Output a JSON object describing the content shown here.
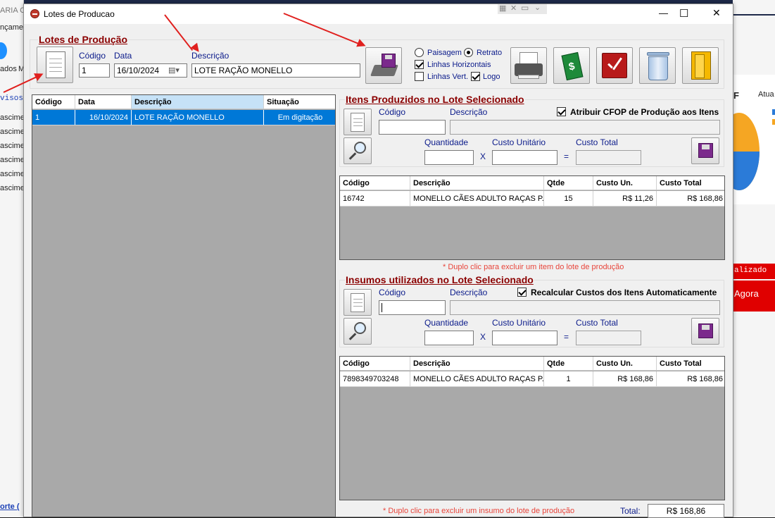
{
  "background": {
    "left_texts": [
      "ARIA C",
      "nçame",
      "ados",
      "M",
      "visos",
      "ascime",
      "ascime",
      "ascime",
      "ascime",
      "ascime",
      "ascime",
      "orte ("
    ],
    "right_texts": [
      "F",
      "Atua",
      "alizado",
      "Agora"
    ]
  },
  "window": {
    "title": "Lotes de Producao",
    "controls": {
      "minimize": "—",
      "maximize": "☐",
      "close": "✕"
    }
  },
  "header": {
    "section_title": "Lotes de Produção",
    "codigo_label": "Código",
    "codigo_value": "1",
    "data_label": "Data",
    "data_value": "16/10/2024",
    "descricao_label": "Descrição",
    "descricao_value": "LOTE RAÇÃO MONELLO"
  },
  "print_options": {
    "paisagem": "Paisagem",
    "retrato": "Retrato",
    "linhas_horizontais": "Linhas Horizontais",
    "linhas_vert": "Linhas Vert.",
    "logo": "Logo",
    "paisagem_selected": false,
    "retrato_selected": true,
    "linhas_horizontais_checked": true,
    "linhas_vert_checked": false,
    "logo_checked": true
  },
  "lots_table": {
    "headers": [
      "Código",
      "Data",
      "Descrição",
      "Situação"
    ],
    "rows": [
      {
        "codigo": "1",
        "data": "16/10/2024",
        "descricao": "LOTE RAÇÃO MONELLO",
        "situacao": "Em digitação"
      }
    ]
  },
  "produced": {
    "title": "Itens Produzidos no Lote Selecionado",
    "codigo_label": "Código",
    "descricao_label": "Descrição",
    "atribuir_label": "Atribuir CFOP de Produção aos Itens",
    "atribuir_checked": true,
    "quantidade_label": "Quantidade",
    "custo_unitario_label": "Custo Unitário",
    "custo_total_label": "Custo Total",
    "x_sign": "X",
    "eq_sign": "=",
    "headers": [
      "Código",
      "Descrição",
      "Qtde",
      "Custo Un.",
      "Custo Total"
    ],
    "rows": [
      {
        "codigo": "16742",
        "descricao": "MONELLO CÃES ADULTO RAÇAS P...",
        "qtde": "15",
        "custo_un": "R$ 11,26",
        "custo_total": "R$ 168,86"
      }
    ],
    "hint": "* Duplo clic para excluir um item do lote de produção"
  },
  "inputs_section": {
    "title": "Insumos utilizados no Lote Selecionado",
    "codigo_label": "Código",
    "descricao_label": "Descrição",
    "recalcular_label": "Recalcular Custos dos Itens Automaticamente",
    "recalcular_checked": true,
    "quantidade_label": "Quantidade",
    "custo_unitario_label": "Custo Unitário",
    "custo_total_label": "Custo Total",
    "x_sign": "X",
    "eq_sign": "=",
    "headers": [
      "Código",
      "Descrição",
      "Qtde",
      "Custo Un.",
      "Custo Total"
    ],
    "rows": [
      {
        "codigo": "7898349703248",
        "descricao": "MONELLO CÃES ADULTO RAÇAS P...",
        "qtde": "1",
        "custo_un": "R$ 168,86",
        "custo_total": "R$ 168,86"
      }
    ],
    "hint": "* Duplo clic para excluir um insumo do lote de produção",
    "total_label": "Total:",
    "total_value": "R$ 168,86"
  },
  "colors": {
    "section_title": "#8b0000",
    "label_blue": "#0a1a8a",
    "selection": "#0078d7",
    "hint": "#e8443a",
    "arrow": "#e0201e"
  }
}
